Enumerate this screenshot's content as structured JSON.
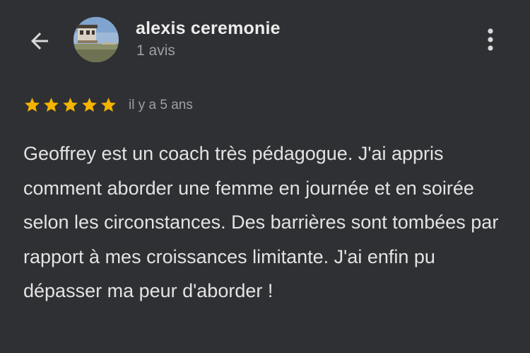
{
  "header": {
    "back_icon": "arrow-left-icon",
    "avatar_icon": "avatar-photo",
    "user_name": "alexis ceremonie",
    "review_count": "1 avis",
    "more_icon": "more-vert-icon"
  },
  "review": {
    "rating": 5,
    "rating_max": 5,
    "star_color": "#f4b400",
    "age": "il y a 5 ans",
    "text": "Geoffrey est un coach très pédagogue. J'ai appris comment aborder une femme en journée et en soirée selon les circonstances. Des barrières sont tombées par rapport à mes croissances limitante. J'ai enfin pu dépasser ma peur d'aborder !"
  },
  "colors": {
    "background": "#2f3033",
    "text_primary": "#e3e3e3",
    "text_secondary": "#9aa0a6",
    "star": "#f4b400"
  }
}
